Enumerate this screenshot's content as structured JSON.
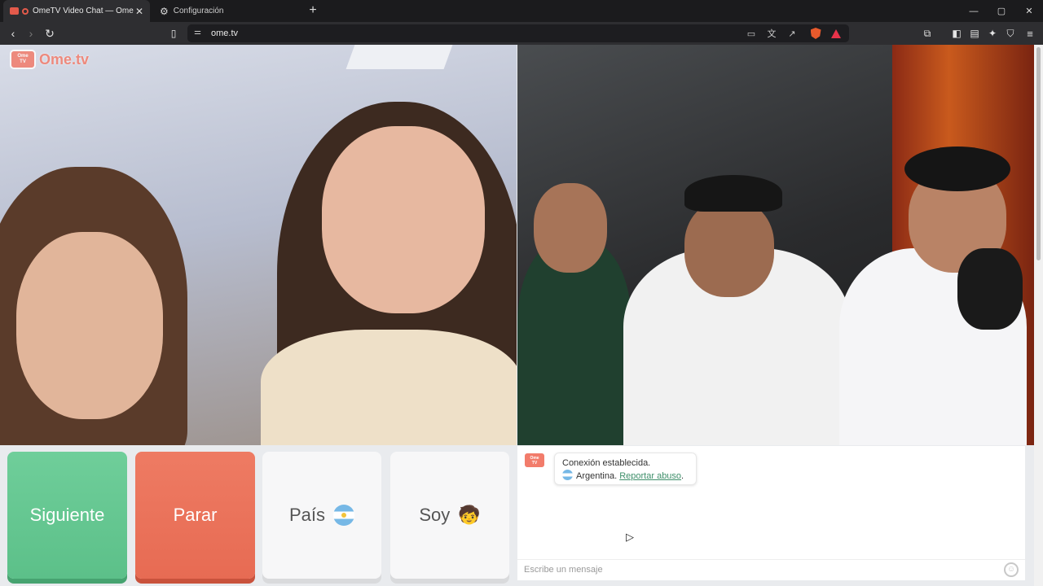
{
  "browser": {
    "tabs": [
      {
        "title": "OmeTV Video Chat — Omeg",
        "active": true
      },
      {
        "title": "Configuración",
        "active": false
      }
    ],
    "new_tab": "+",
    "address": "ome.tv",
    "window_controls": {
      "minimize": "—",
      "maximize": "▢",
      "close": "✕"
    },
    "icons": [
      "back-icon",
      "forward-icon",
      "reload-icon",
      "bookmark-icon",
      "site-settings-icon",
      "screen-icon",
      "translate-icon",
      "share-icon",
      "brave-shields-icon",
      "brave-rewards-icon",
      "screenshot-icon",
      "sidebar-icon",
      "wallet-icon",
      "leo-icon",
      "vpn-icon",
      "menu-icon"
    ]
  },
  "site": {
    "logo_text": "Ome.tv",
    "logo_badge_line1": "Ome",
    "logo_badge_line2": "TV"
  },
  "controls": {
    "next_label": "Siguiente",
    "stop_label": "Parar",
    "country_label": "País",
    "soy_label": "Soy",
    "soy_emoji": "🧒"
  },
  "chat": {
    "message_line1": "Conexión establecida.",
    "country": "Argentina.",
    "report_link": "Reportar abuso",
    "report_suffix": ".",
    "input_placeholder": "Escribe un mensaje"
  },
  "colors": {
    "next": "#5cc089",
    "stop": "#e76b53",
    "brand": "#f27c6b",
    "link": "#3e8f6a"
  }
}
